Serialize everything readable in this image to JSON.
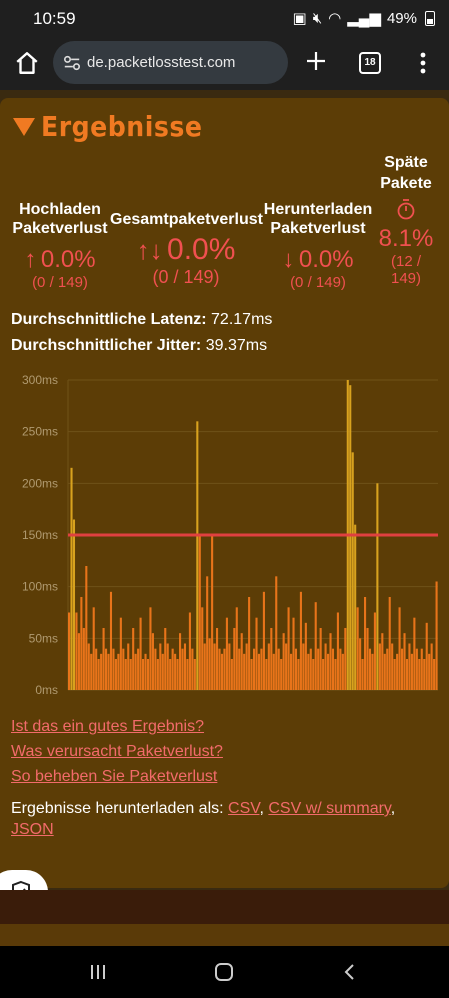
{
  "status_bar": {
    "time": "10:59",
    "battery": "49%"
  },
  "browser": {
    "url": "de.packetlosstest.com",
    "tab_count": "18"
  },
  "results": {
    "title": "Ergebnisse",
    "stats": [
      {
        "label": "Hochladen Paketverlust",
        "arrow": "↑",
        "value": "0.0%",
        "count": "(0 / 149)"
      },
      {
        "label": "Gesamtpaketverlust",
        "arrow": "↑↓",
        "value": "0.0%",
        "count": "(0 / 149)"
      },
      {
        "label": "Herunterladen Paketverlust",
        "arrow": "↓",
        "value": "0.0%",
        "count": "(0 / 149)"
      },
      {
        "label": "Späte Pakete",
        "icon": "stopwatch-icon",
        "value": "8.1%",
        "count": "(12 / 149)"
      }
    ],
    "latency_label": "Durchschnittliche Latenz:",
    "latency_value": "72.17ms",
    "jitter_label": "Durchschnittlicher Jitter:",
    "jitter_value": "39.37ms"
  },
  "chart_data": {
    "type": "bar",
    "y_ticks": [
      "300ms",
      "250ms",
      "200ms",
      "150ms",
      "100ms",
      "50ms",
      "0ms"
    ],
    "ylim": [
      0,
      300
    ],
    "threshold": 150,
    "colors": {
      "normal": "#e8741a",
      "late": "#d8a21e",
      "threshold": "#e04040",
      "grid": "#6f5218",
      "tick": "#b09a70"
    },
    "values": [
      75,
      215,
      165,
      75,
      55,
      90,
      60,
      120,
      45,
      35,
      80,
      40,
      30,
      35,
      60,
      40,
      35,
      95,
      40,
      30,
      35,
      70,
      40,
      30,
      45,
      30,
      60,
      35,
      40,
      70,
      30,
      35,
      30,
      80,
      55,
      40,
      30,
      45,
      35,
      60,
      45,
      30,
      40,
      35,
      30,
      55,
      40,
      45,
      30,
      75,
      40,
      30,
      260,
      150,
      80,
      45,
      110,
      50,
      150,
      45,
      60,
      40,
      35,
      40,
      70,
      45,
      30,
      60,
      80,
      40,
      55,
      35,
      45,
      90,
      30,
      40,
      70,
      35,
      40,
      95,
      30,
      45,
      60,
      35,
      110,
      40,
      30,
      55,
      45,
      80,
      35,
      70,
      40,
      30,
      95,
      45,
      65,
      35,
      40,
      30,
      85,
      40,
      60,
      30,
      45,
      35,
      55,
      40,
      30,
      75,
      40,
      35,
      60,
      300,
      295,
      230,
      160,
      80,
      50,
      30,
      90,
      60,
      40,
      35,
      75,
      200,
      45,
      55,
      35,
      40,
      90,
      45,
      30,
      35,
      80,
      40,
      55,
      30,
      45,
      35,
      70,
      40,
      30,
      40,
      30,
      65,
      35,
      45,
      30,
      105
    ]
  },
  "links": {
    "good_result": "Ist das ein gutes Ergebnis?",
    "cause": "Was verursacht Paketverlust?",
    "fix": "So beheben Sie Paketverlust"
  },
  "download": {
    "label": "Ergebnisse herunterladen als:",
    "csv": "CSV",
    "csv_summary": "CSV w/ summary",
    "json": "JSON"
  }
}
